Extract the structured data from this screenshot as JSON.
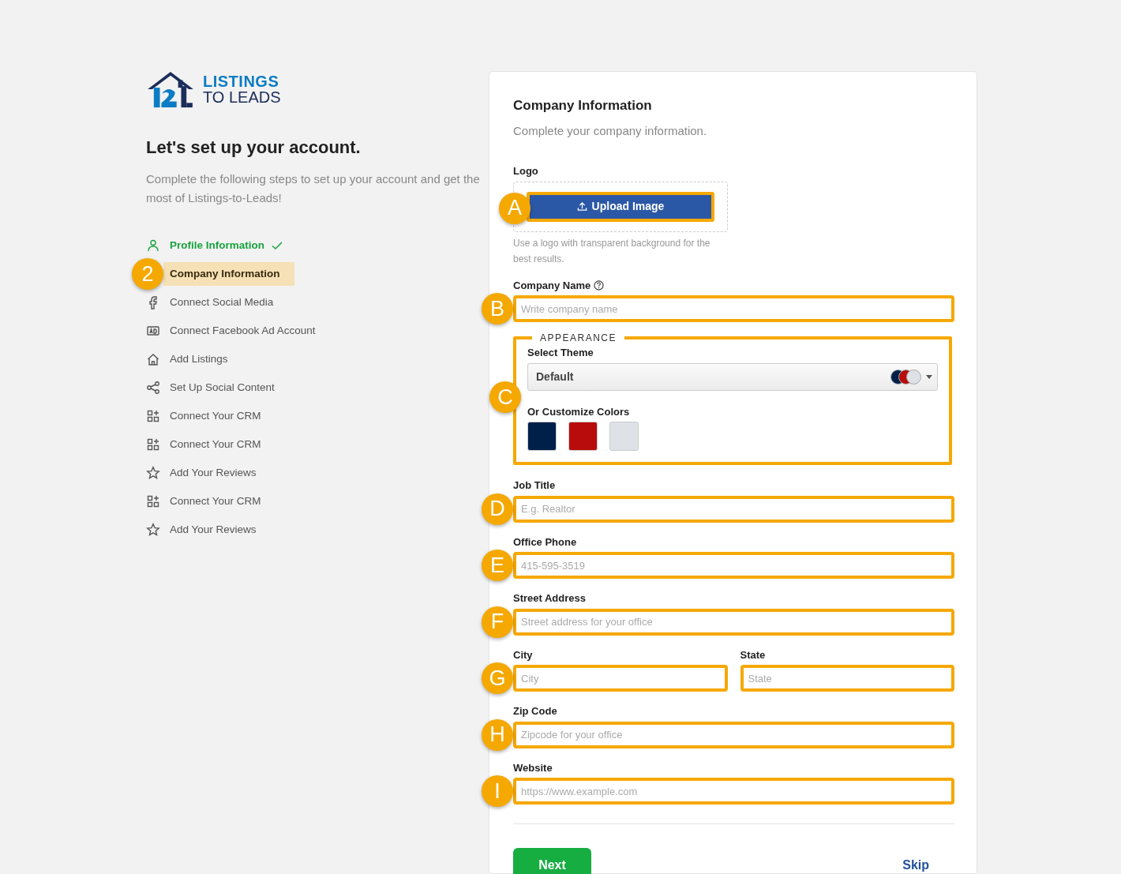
{
  "brand": {
    "line1": "LISTINGS",
    "line2": "TO LEADS"
  },
  "heading": "Let's set up your account.",
  "intro": "Complete the following steps to set up your account and get the most of Listings-to-Leads!",
  "steps": [
    {
      "label": "Profile Information",
      "kind": "profile",
      "completed": true,
      "selected": false
    },
    {
      "label": "Company Information",
      "completed": false,
      "selected": true,
      "marker": "2"
    },
    {
      "label": "Connect Social Media",
      "kind": "social",
      "completed": false,
      "selected": false
    },
    {
      "label": "Connect Facebook Ad Account",
      "kind": "ad",
      "completed": false,
      "selected": false
    },
    {
      "label": "Add Listings",
      "kind": "listings",
      "completed": false,
      "selected": false
    },
    {
      "label": "Set Up Social Content",
      "kind": "content",
      "completed": false,
      "selected": false
    },
    {
      "label": "Connect Your CRM",
      "kind": "crm",
      "completed": false,
      "selected": false
    },
    {
      "label": "Connect Your CRM",
      "kind": "crm",
      "completed": false,
      "selected": false
    },
    {
      "label": "Add Your Reviews",
      "kind": "reviews",
      "completed": false,
      "selected": false
    },
    {
      "label": "Connect Your CRM",
      "kind": "crm",
      "completed": false,
      "selected": false
    },
    {
      "label": "Add Your Reviews",
      "kind": "reviews",
      "completed": false,
      "selected": false
    }
  ],
  "form": {
    "title": "Company Information",
    "subtitle": "Complete your company information.",
    "fields": [
      {
        "kind": "upload",
        "label": "Logo",
        "button": "Upload Image",
        "marker": "A",
        "highlighted": true,
        "hint": "Use a logo with transparent background for the best results."
      },
      {
        "kind": "text",
        "label": "Company Name",
        "help": true,
        "placeholder": "Write company name",
        "marker": "B",
        "highlighted": true
      },
      {
        "kind": "appearance",
        "legend": "APPEARANCE",
        "marker": "C",
        "highlighted": true,
        "theme_label": "Select Theme",
        "theme_value": "Default",
        "theme_colors": [
          {
            "color": "#00204a"
          },
          {
            "color": "#b80c0c"
          },
          {
            "color": "#dee1e6"
          }
        ],
        "custom_label": "Or Customize Colors",
        "swatches": [
          {
            "color": "#00204a"
          },
          {
            "color": "#b80c0c"
          },
          {
            "color": "#dee1e6"
          }
        ]
      },
      {
        "kind": "text",
        "label": "Job Title",
        "placeholder": "E.g. Realtor",
        "marker": "D",
        "highlighted": true
      },
      {
        "kind": "text",
        "label": "Office Phone",
        "placeholder": "415-595-3519",
        "marker": "E",
        "highlighted": true
      },
      {
        "kind": "text",
        "label": "Street Address",
        "placeholder": "Street address for your office",
        "marker": "F",
        "highlighted": true
      },
      {
        "kind": "row",
        "items": [
          {
            "kind": "text",
            "label": "City",
            "placeholder": "City",
            "marker": "G",
            "highlighted": true
          },
          {
            "kind": "text",
            "label": "State",
            "placeholder": "State",
            "highlighted": true
          }
        ]
      },
      {
        "kind": "text",
        "label": "Zip Code",
        "placeholder": "Zipcode for your office",
        "marker": "H",
        "highlighted": true
      },
      {
        "kind": "text",
        "label": "Website",
        "placeholder": "https://www.example.com",
        "marker": "I",
        "highlighted": true
      }
    ],
    "next": "Next",
    "skip": "Skip"
  }
}
